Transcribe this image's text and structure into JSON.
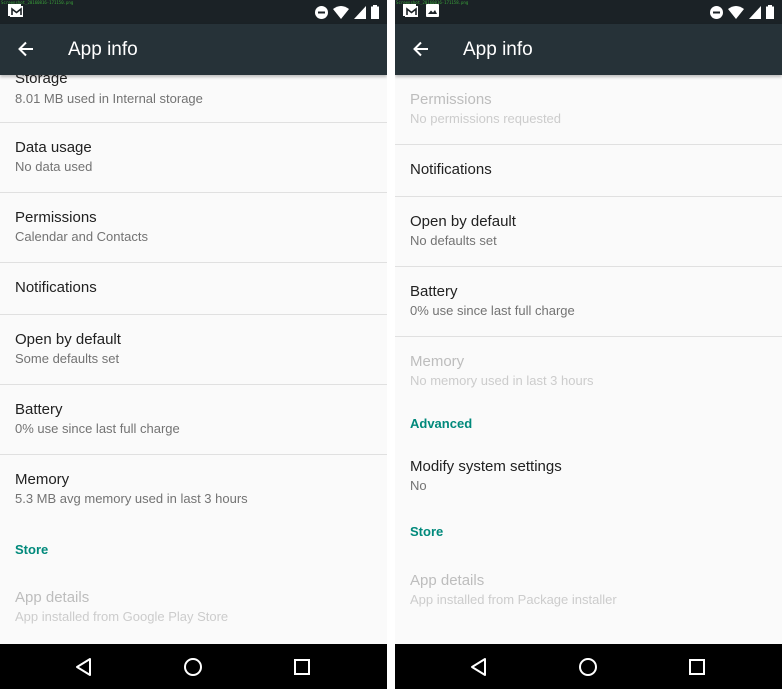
{
  "colors": {
    "statusbar": "#1b2226",
    "appbar": "#263238",
    "accent": "#00897b",
    "background": "#fafafa"
  },
  "screens": [
    {
      "filename": "Screenshot_20160816-171150.png",
      "status_icons_left": [
        "gmail-icon"
      ],
      "status_icons_right": [
        "do-not-disturb-icon",
        "wifi-icon",
        "signal-icon",
        "battery-icon"
      ],
      "appbar": {
        "back_icon": "arrow-back-icon",
        "title": "App info"
      },
      "items": [
        {
          "type": "item",
          "title": "Storage",
          "subtitle": "8.01 MB used in Internal storage"
        },
        {
          "type": "item",
          "title": "Data usage",
          "subtitle": "No data used"
        },
        {
          "type": "item",
          "title": "Permissions",
          "subtitle": "Calendar and Contacts"
        },
        {
          "type": "item",
          "title": "Notifications"
        },
        {
          "type": "item",
          "title": "Open by default",
          "subtitle": "Some defaults set"
        },
        {
          "type": "item",
          "title": "Battery",
          "subtitle": "0% use since last full charge"
        },
        {
          "type": "item",
          "title": "Memory",
          "subtitle": "5.3 MB avg memory used in last 3 hours"
        },
        {
          "type": "header",
          "title": "Store"
        },
        {
          "type": "item",
          "title": "App details",
          "subtitle": "App installed from Google Play Store",
          "disabled": true
        }
      ]
    },
    {
      "filename": "Screenshot_20160816-171158.png",
      "status_icons_left": [
        "gmail-icon",
        "image-icon"
      ],
      "status_icons_right": [
        "do-not-disturb-icon",
        "wifi-icon",
        "signal-icon",
        "battery-icon"
      ],
      "appbar": {
        "back_icon": "arrow-back-icon",
        "title": "App info"
      },
      "items": [
        {
          "type": "item",
          "title": "Permissions",
          "subtitle": "No permissions requested",
          "disabled": true
        },
        {
          "type": "item",
          "title": "Notifications"
        },
        {
          "type": "item",
          "title": "Open by default",
          "subtitle": "No defaults set"
        },
        {
          "type": "item",
          "title": "Battery",
          "subtitle": "0% use since last full charge"
        },
        {
          "type": "item",
          "title": "Memory",
          "subtitle": "No memory used in last 3 hours",
          "disabled": true
        },
        {
          "type": "header",
          "title": "Advanced"
        },
        {
          "type": "item",
          "title": "Modify system settings",
          "subtitle": "No"
        },
        {
          "type": "header",
          "title": "Store"
        },
        {
          "type": "item",
          "title": "App details",
          "subtitle": "App installed from Package installer",
          "disabled": true
        }
      ]
    }
  ],
  "navbar": {
    "buttons": [
      "back",
      "home",
      "recents"
    ]
  }
}
